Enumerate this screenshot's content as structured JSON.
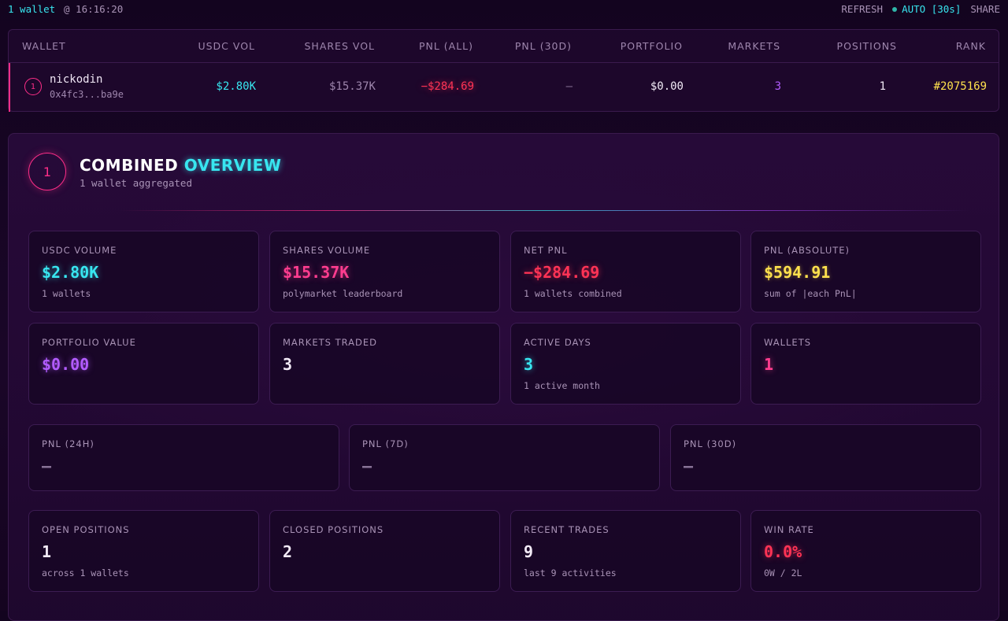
{
  "topbar": {
    "wallet_count": "1 wallet",
    "time": "@ 16:16:20",
    "refresh": "REFRESH",
    "auto": "AUTO [30s]",
    "share": "SHARE"
  },
  "wallet_table": {
    "headers": {
      "wallet": "WALLET",
      "usdc_vol": "USDC VOL",
      "shares_vol": "SHARES VOL",
      "pnl_all": "PNL (ALL)",
      "pnl_30d": "PNL (30D)",
      "portfolio": "PORTFOLIO",
      "markets": "MARKETS",
      "positions": "POSITIONS",
      "rank": "RANK"
    },
    "rows": [
      {
        "index": "1",
        "name": "nickodin",
        "address": "0x4fc3...ba9e",
        "usdc_vol": "$2.80K",
        "shares_vol": "$15.37K",
        "pnl_all": "−$284.69",
        "pnl_30d": "—",
        "portfolio": "$0.00",
        "markets": "3",
        "positions": "1",
        "rank": "#2075169"
      }
    ]
  },
  "overview": {
    "badge": "1",
    "title_word1": "COMBINED",
    "title_word2": "OVERVIEW",
    "subtitle": "1 wallet aggregated",
    "stats": {
      "usdc_volume": {
        "label": "USDC VOLUME",
        "value": "$2.80K",
        "sub": "1 wallets"
      },
      "shares_volume": {
        "label": "SHARES VOLUME",
        "value": "$15.37K",
        "sub": "polymarket leaderboard"
      },
      "net_pnl": {
        "label": "NET PNL",
        "value": "−$284.69",
        "sub": "1 wallets combined"
      },
      "pnl_absolute": {
        "label": "PNL (ABSOLUTE)",
        "value": "$594.91",
        "sub": "sum of |each PnL|"
      },
      "portfolio_value": {
        "label": "PORTFOLIO VALUE",
        "value": "$0.00"
      },
      "markets_traded": {
        "label": "MARKETS TRADED",
        "value": "3"
      },
      "active_days": {
        "label": "ACTIVE DAYS",
        "value": "3",
        "sub": "1 active month"
      },
      "wallets": {
        "label": "WALLETS",
        "value": "1"
      },
      "pnl_24h": {
        "label": "PNL (24H)",
        "value": "—"
      },
      "pnl_7d": {
        "label": "PNL (7D)",
        "value": "—"
      },
      "pnl_30d": {
        "label": "PNL (30D)",
        "value": "—"
      },
      "open_positions": {
        "label": "OPEN POSITIONS",
        "value": "1",
        "sub": "across 1 wallets"
      },
      "closed_positions": {
        "label": "CLOSED POSITIONS",
        "value": "2"
      },
      "recent_trades": {
        "label": "RECENT TRADES",
        "value": "9",
        "sub": "last 9 activities"
      },
      "win_rate": {
        "label": "WIN RATE",
        "value": "0.0%",
        "sub": "0W / 2L"
      }
    }
  },
  "colors": {
    "accent_cyan": "#38e6f0",
    "accent_pink": "#ff2e88",
    "negative_red": "#ff3355",
    "highlight_yellow": "#ffe14d",
    "accent_purple": "#b25cff"
  }
}
